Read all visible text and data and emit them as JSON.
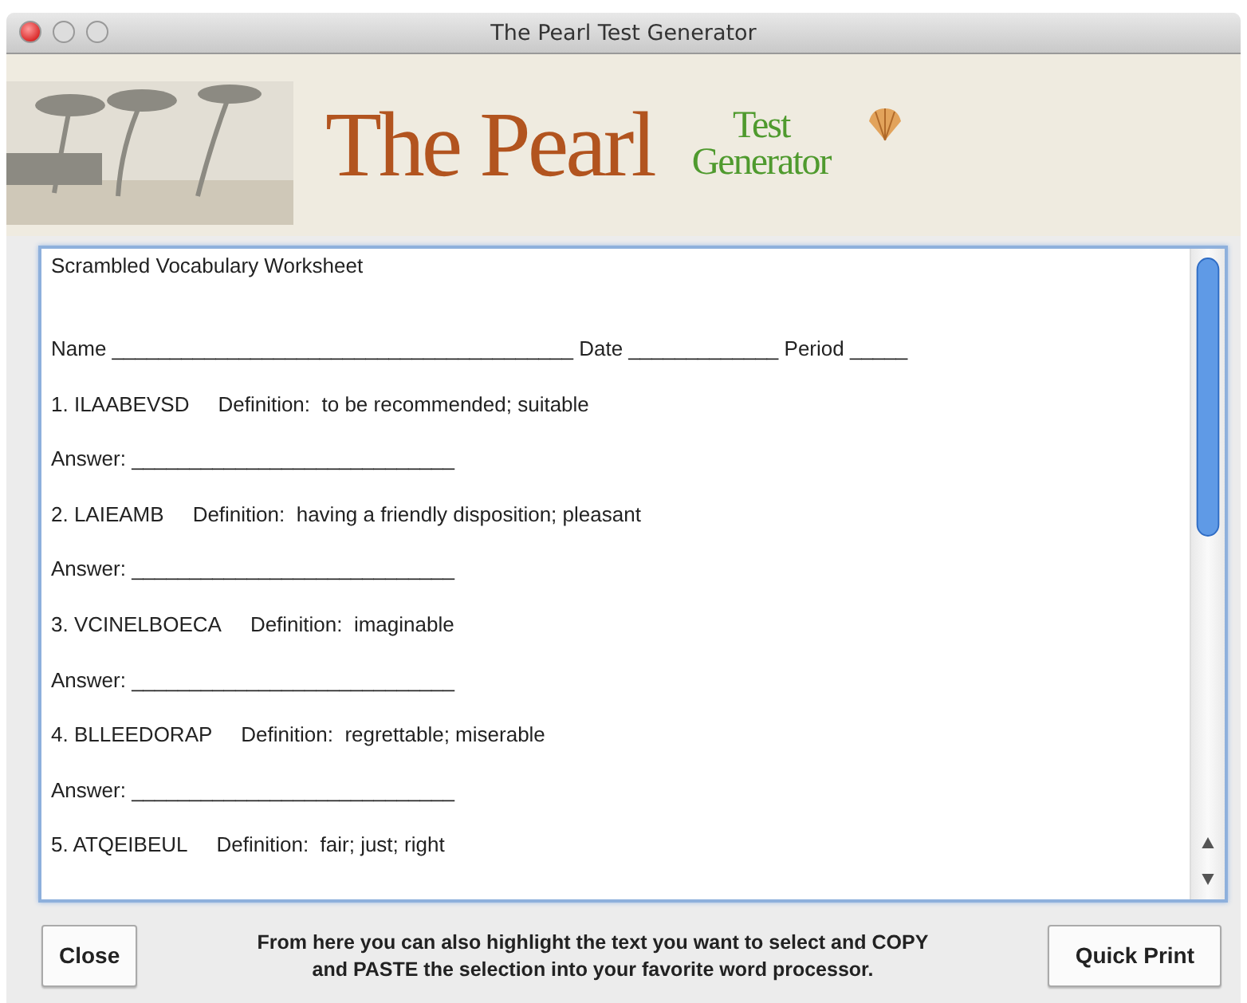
{
  "window": {
    "title": "The Pearl Test Generator"
  },
  "banner": {
    "title": "The Pearl",
    "subtitle_top": "Test",
    "subtitle_bottom": "Generator"
  },
  "worksheet": {
    "heading": "Scrambled Vocabulary Worksheet",
    "name_line": "Name ________________________________________ Date _____________ Period _____",
    "items": [
      {
        "question": "1. ILAABEVSD",
        "definition": "Definition:  to be recommended; suitable",
        "answer": "Answer: ____________________________"
      },
      {
        "question": "2. LAIEAMB",
        "definition": "Definition:  having a friendly disposition; pleasant",
        "answer": "Answer: ____________________________"
      },
      {
        "question": "3. VCINELBOECA",
        "definition": "Definition:  imaginable",
        "answer": "Answer: ____________________________"
      },
      {
        "question": "4. BLLEEDORAP",
        "definition": "Definition:  regrettable; miserable",
        "answer": "Answer: ____________________________"
      },
      {
        "question": "5. ATQEIBEUL",
        "definition": "Definition:  fair; just; right"
      }
    ]
  },
  "footer": {
    "close_button": "Close",
    "hint": "From here you can also highlight the text you want to select and COPY and PASTE the selection into your favorite word processor.",
    "print_button": "Quick Print"
  }
}
